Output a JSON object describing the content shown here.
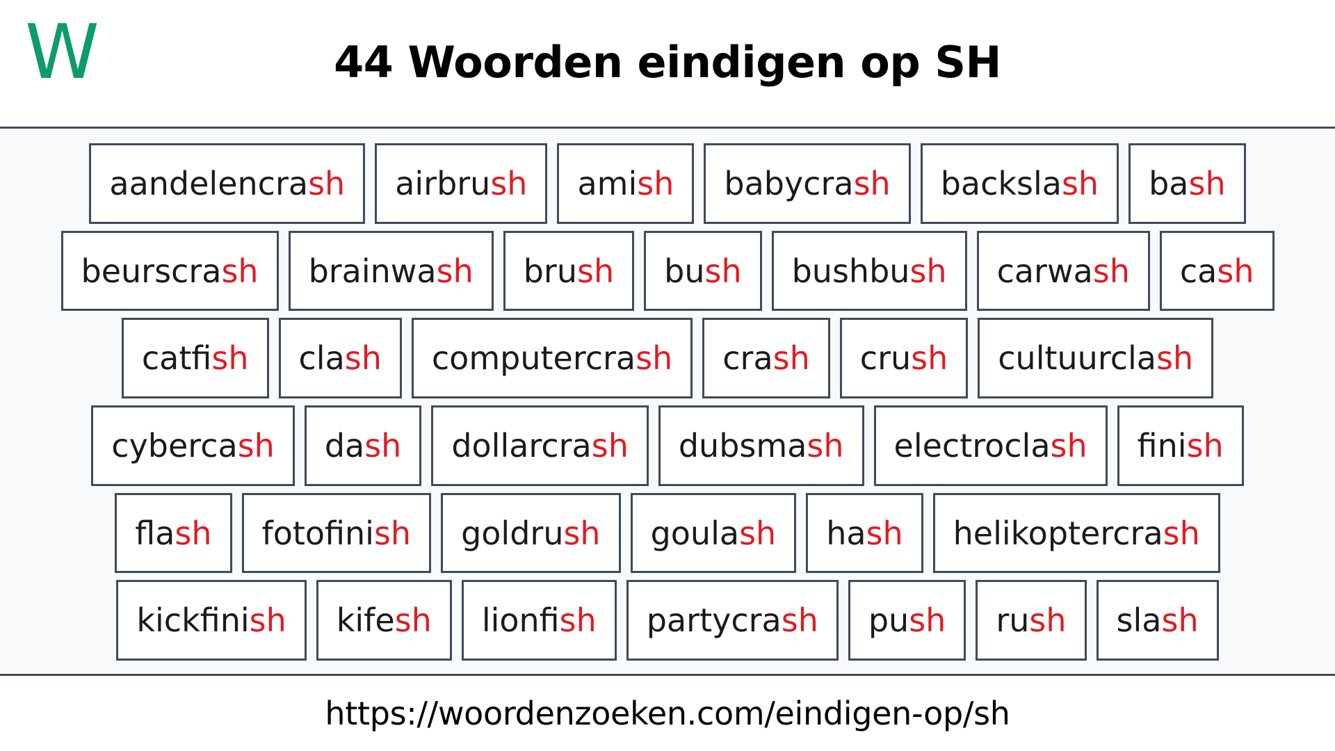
{
  "header": {
    "logo_text": "W",
    "logo_color": "#0d9b68",
    "title": "44 Woorden eindigen op SH"
  },
  "theme": {
    "background": "#ffffff",
    "grid_background": "#f7f9fb",
    "box_border": "#3f4a5a",
    "box_fill": "#ffffff",
    "text_color": "#1a1a1a",
    "highlight_color": "#e11b22"
  },
  "word_grid": {
    "highlight_suffix": "sh",
    "total_count": 44,
    "rows": [
      [
        {
          "word": "aandelencrash",
          "stem": "aandelencra",
          "suffix": "sh"
        },
        {
          "word": "airbrush",
          "stem": "airbru",
          "suffix": "sh"
        },
        {
          "word": "amish",
          "stem": "ami",
          "suffix": "sh"
        },
        {
          "word": "babycrash",
          "stem": "babycra",
          "suffix": "sh"
        },
        {
          "word": "backslash",
          "stem": "backsla",
          "suffix": "sh"
        },
        {
          "word": "bash",
          "stem": "ba",
          "suffix": "sh"
        }
      ],
      [
        {
          "word": "beurscrash",
          "stem": "beurscra",
          "suffix": "sh"
        },
        {
          "word": "brainwash",
          "stem": "brainwa",
          "suffix": "sh"
        },
        {
          "word": "brush",
          "stem": "bru",
          "suffix": "sh"
        },
        {
          "word": "bush",
          "stem": "bu",
          "suffix": "sh"
        },
        {
          "word": "bushbush",
          "stem": "bushbu",
          "suffix": "sh"
        },
        {
          "word": "carwash",
          "stem": "carwa",
          "suffix": "sh"
        },
        {
          "word": "cash",
          "stem": "ca",
          "suffix": "sh"
        }
      ],
      [
        {
          "word": "catfish",
          "stem": "catfi",
          "suffix": "sh"
        },
        {
          "word": "clash",
          "stem": "cla",
          "suffix": "sh"
        },
        {
          "word": "computercrash",
          "stem": "computercra",
          "suffix": "sh"
        },
        {
          "word": "crash",
          "stem": "cra",
          "suffix": "sh"
        },
        {
          "word": "crush",
          "stem": "cru",
          "suffix": "sh"
        },
        {
          "word": "cultuurclash",
          "stem": "cultuurcla",
          "suffix": "sh"
        }
      ],
      [
        {
          "word": "cybercash",
          "stem": "cyberca",
          "suffix": "sh"
        },
        {
          "word": "dash",
          "stem": "da",
          "suffix": "sh"
        },
        {
          "word": "dollarcrash",
          "stem": "dollarcra",
          "suffix": "sh"
        },
        {
          "word": "dubsmash",
          "stem": "dubsma",
          "suffix": "sh"
        },
        {
          "word": "electroclash",
          "stem": "electrocla",
          "suffix": "sh"
        },
        {
          "word": "finish",
          "stem": "fini",
          "suffix": "sh"
        }
      ],
      [
        {
          "word": "flash",
          "stem": "fla",
          "suffix": "sh"
        },
        {
          "word": "fotofinish",
          "stem": "fotofini",
          "suffix": "sh"
        },
        {
          "word": "goldrush",
          "stem": "goldru",
          "suffix": "sh"
        },
        {
          "word": "goulash",
          "stem": "goula",
          "suffix": "sh"
        },
        {
          "word": "hash",
          "stem": "ha",
          "suffix": "sh"
        },
        {
          "word": "helikoptercrash",
          "stem": "helikoptercra",
          "suffix": "sh"
        }
      ],
      [
        {
          "word": "kickfinish",
          "stem": "kickfini",
          "suffix": "sh"
        },
        {
          "word": "kifesh",
          "stem": "kife",
          "suffix": "sh"
        },
        {
          "word": "lionfish",
          "stem": "lionfi",
          "suffix": "sh"
        },
        {
          "word": "partycrash",
          "stem": "partycra",
          "suffix": "sh"
        },
        {
          "word": "push",
          "stem": "pu",
          "suffix": "sh"
        },
        {
          "word": "rush",
          "stem": "ru",
          "suffix": "sh"
        },
        {
          "word": "slash",
          "stem": "sla",
          "suffix": "sh"
        }
      ]
    ]
  },
  "footer": {
    "url": "https://woordenzoeken.com/eindigen-op/sh"
  }
}
